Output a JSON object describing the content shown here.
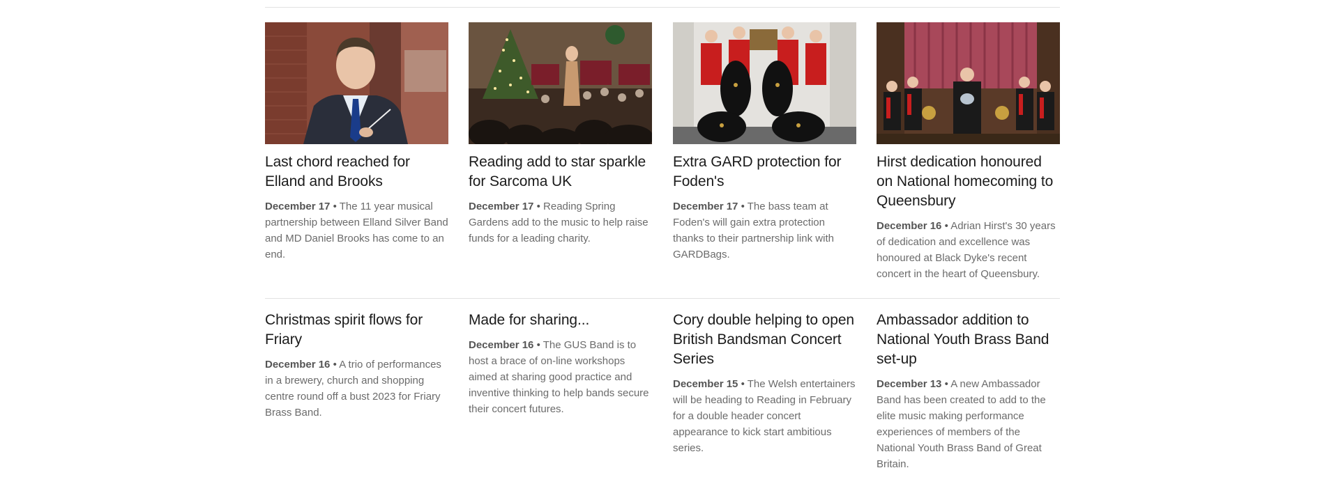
{
  "articles": [
    {
      "title": "Last chord reached for Elland and Brooks",
      "date": "December 17",
      "separator": "•",
      "summary": "The 11 year musical partnership between Elland Silver Band and MD Daniel Brooks has come to an end.",
      "image": "conductor-portrait-photo"
    },
    {
      "title": "Reading add to star sparkle for Sarcoma UK",
      "date": "December 17",
      "separator": "•",
      "summary": "Reading Spring Gardens add to the music to help raise funds for a leading charity.",
      "image": "christmas-concert-photo"
    },
    {
      "title": "Extra GARD protection for Foden's",
      "date": "December 17",
      "separator": "•",
      "summary": "The bass team at Foden's will gain extra protection thanks to their partnership link with GARDBags.",
      "image": "bass-players-gardbags-photo"
    },
    {
      "title": "Hirst dedication honoured on National homecoming to Queensbury",
      "date": "December 16",
      "separator": "•",
      "summary": "Adrian Hirst's 30 years of dedication and excellence was honoured at Black Dyke's recent concert in the heart of Queensbury.",
      "image": "band-presentation-photo"
    },
    {
      "title": "Christmas spirit flows for Friary",
      "date": "December 16",
      "separator": "•",
      "summary": "A trio of performances in a brewery, church and shopping centre round off a bust 2023 for Friary Brass Band."
    },
    {
      "title": "Made for sharing...",
      "date": "December 16",
      "separator": "•",
      "summary": "The GUS Band is to host a brace of on-line workshops aimed at sharing good practice and inventive thinking to help bands secure their concert futures."
    },
    {
      "title": "Cory double helping to open British Bandsman Concert Series",
      "date": "December 15",
      "separator": "•",
      "summary": "The Welsh entertainers will be heading to Reading in February for a double header concert appearance to kick start ambitious series."
    },
    {
      "title": "Ambassador addition to National Youth Brass Band set-up",
      "date": "December 13",
      "separator": "•",
      "summary": "A new Ambassador Band has been created to add to the elite music making performance experiences of members of the National Youth Brass Band of Great Britain."
    }
  ],
  "colors": {
    "title": "#1b1b1b",
    "summary": "#6b6b6b",
    "date": "#555555",
    "rule": "#e2e2e2"
  }
}
